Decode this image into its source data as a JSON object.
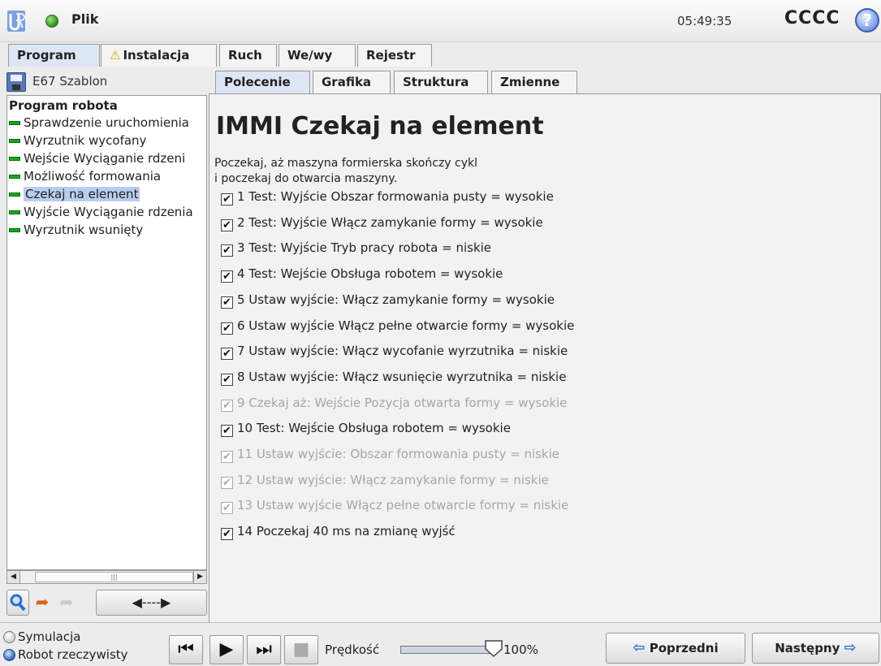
{
  "header": {
    "file_menu": "Plik",
    "clock": "05:49:35",
    "robot_name": "CCCC",
    "help": "?"
  },
  "main_tabs": [
    "Program",
    "Instalacja",
    "Ruch",
    "We/wy",
    "Rejestr"
  ],
  "left": {
    "program_name": "E67 Szablon",
    "tree_root": "Program robota",
    "tree_items": [
      "Sprawdzenie uruchomienia",
      "Wyrzutnik wycofany",
      "Wejście Wyciąganie rdzeni",
      "Możliwość formowania",
      "Czekaj na element",
      "Wyjście Wyciąganie rdzenia",
      "Wyrzutnik wsunięty"
    ],
    "selected_item": "Czekaj na element"
  },
  "sub_tabs": [
    "Polecenie",
    "Grafika",
    "Struktura",
    "Zmienne"
  ],
  "content": {
    "title": "IMMI Czekaj na element",
    "description_line1": "Poczekaj, aż maszyna formierska skończy cykl",
    "description_line2": "i poczekaj do otwarcia maszyny.",
    "steps": [
      {
        "text": "1 Test: Wyjście Obszar formowania pusty = wysokie",
        "enabled": true
      },
      {
        "text": "2 Test: Wyjście Włącz zamykanie formy = wysokie",
        "enabled": true
      },
      {
        "text": "3 Test: Wyjście Tryb pracy robota = niskie",
        "enabled": true
      },
      {
        "text": "4 Test: Wejście Obsługa robotem = wysokie",
        "enabled": true
      },
      {
        "text": "5 Ustaw wyjście: Włącz zamykanie formy = wysokie",
        "enabled": true
      },
      {
        "text": "6 Ustaw wyjście Włącz pełne otwarcie formy = wysokie",
        "enabled": true
      },
      {
        "text": "7 Ustaw wyjście: Włącz wycofanie wyrzutnika = niskie",
        "enabled": true
      },
      {
        "text": "8 Ustaw wyjście: Włącz wsunięcie wyrzutnika = niskie",
        "enabled": true
      },
      {
        "text": "9 Czekaj aż: Wejście Pozycja otwarta formy = wysokie",
        "enabled": false
      },
      {
        "text": "10 Test: Wejście Obsługa robotem = wysokie",
        "enabled": true
      },
      {
        "text": "11 Ustaw wyjście: Obszar formowania pusty = niskie",
        "enabled": false
      },
      {
        "text": "12 Ustaw wyjście: Włącz zamykanie formy = niskie",
        "enabled": false
      },
      {
        "text": "13 Ustaw wyjście Włącz pełne otwarcie formy = niskie",
        "enabled": false
      },
      {
        "text": "14 Poczekaj 40 ms na zmianę wyjść",
        "enabled": true
      }
    ]
  },
  "footer": {
    "mode_simulation": "Symulacja",
    "mode_real": "Robot rzeczywisty",
    "selected_mode": "Robot rzeczywisty",
    "speed_label": "Prędkość",
    "speed_value": "100%",
    "speed_fraction": 1.0,
    "prev_label": "Poprzedni",
    "next_label": "Następny"
  },
  "colors": {
    "accent": "#2f6fd0",
    "tree_bar": "#18a81a",
    "selection": "#b9cdee",
    "active_tab": "#dde6f5"
  }
}
